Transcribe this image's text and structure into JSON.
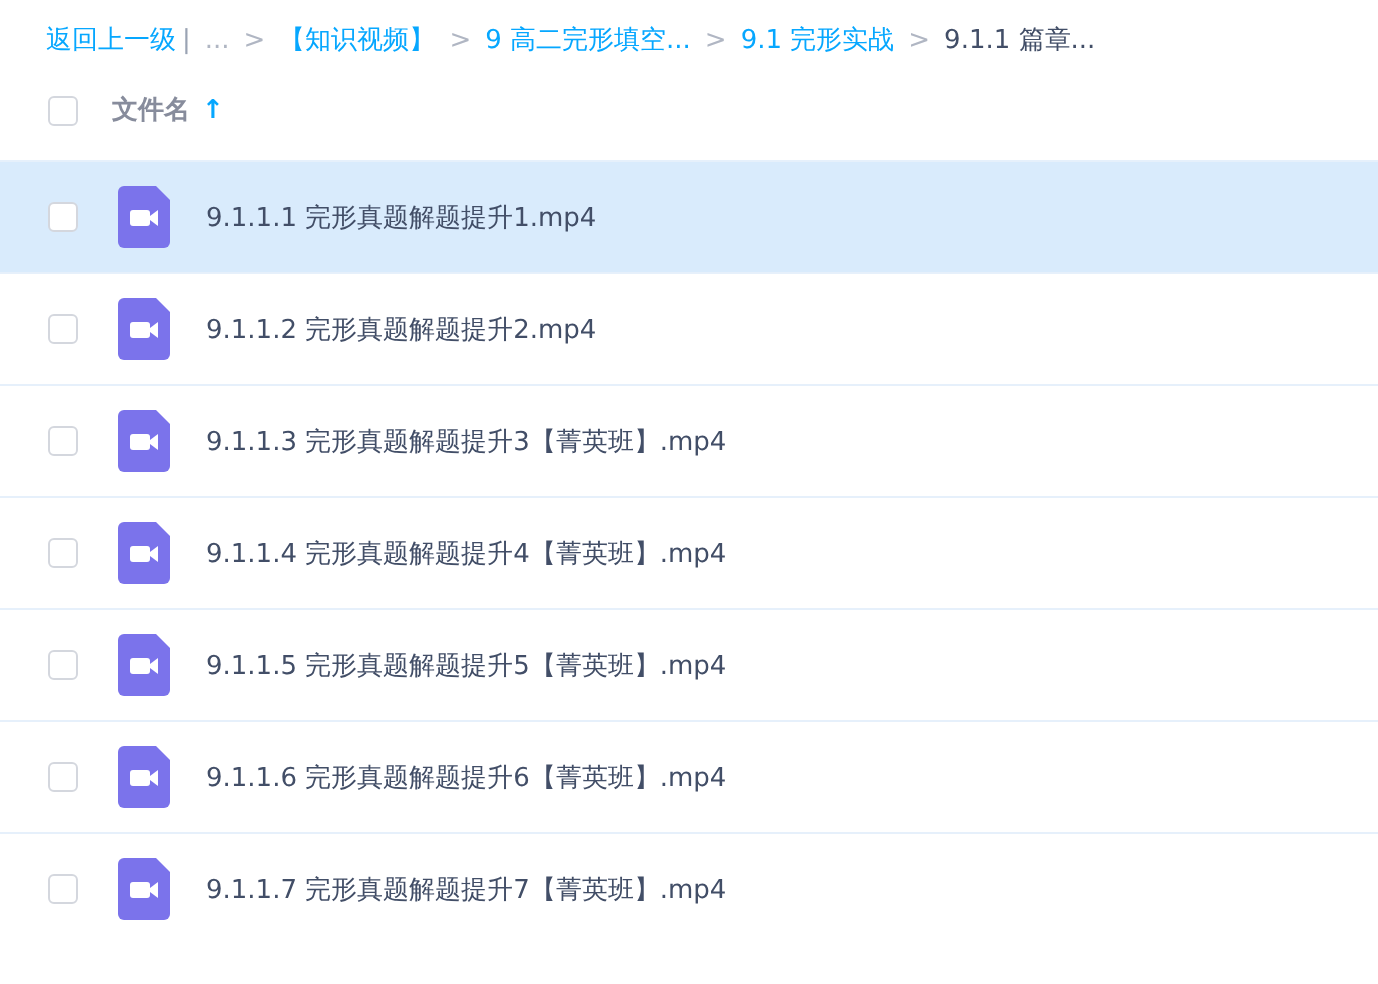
{
  "breadcrumb": {
    "back": "返回上一级",
    "divider": "|",
    "items": [
      {
        "label": "...",
        "kind": "ellipsis"
      },
      {
        "separator": ">",
        "label": "【知识视频】",
        "kind": "link"
      },
      {
        "separator": ">",
        "label": "9 高二完形填空...",
        "kind": "link"
      },
      {
        "separator": ">",
        "label": "9.1 完形实战",
        "kind": "link"
      },
      {
        "separator": ">",
        "label": "9.1.1 篇章...",
        "kind": "current"
      }
    ]
  },
  "header": {
    "checked": false,
    "label": "文件名",
    "sort_arrow": "↑"
  },
  "files": [
    {
      "name": "9.1.1.1 完形真题解题提升1.mp4",
      "checked": false,
      "highlighted": true
    },
    {
      "name": "9.1.1.2 完形真题解题提升2.mp4",
      "checked": false,
      "highlighted": false
    },
    {
      "name": "9.1.1.3 完形真题解题提升3【菁英班】.mp4",
      "checked": false,
      "highlighted": false
    },
    {
      "name": "9.1.1.4 完形真题解题提升4【菁英班】.mp4",
      "checked": false,
      "highlighted": false
    },
    {
      "name": "9.1.1.5 完形真题解题提升5【菁英班】.mp4",
      "checked": false,
      "highlighted": false
    },
    {
      "name": "9.1.1.6 完形真题解题提升6【菁英班】.mp4",
      "checked": false,
      "highlighted": false
    },
    {
      "name": "9.1.1.7 完形真题解题提升7【菁英班】.mp4",
      "checked": false,
      "highlighted": false
    }
  ]
}
